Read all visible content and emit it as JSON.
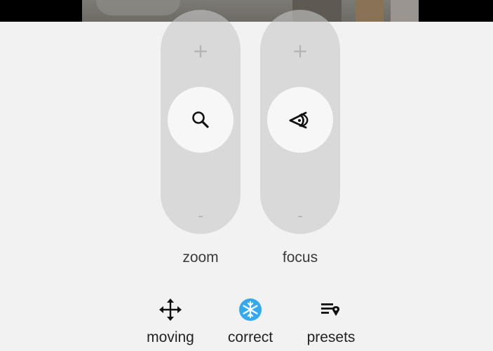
{
  "sliders": {
    "zoom": {
      "plus_label": "+",
      "minus_label": "-",
      "label": "zoom",
      "icon": "magnifier-icon"
    },
    "focus": {
      "plus_label": "+",
      "minus_label": "-",
      "label": "focus",
      "icon": "eye-focus-icon"
    }
  },
  "toolbar": {
    "items": [
      {
        "label": "moving",
        "icon": "move-arrows-icon",
        "active": false
      },
      {
        "label": "correct",
        "icon": "snowflake-icon",
        "active": true
      },
      {
        "label": "presets",
        "icon": "list-location-icon",
        "active": false
      }
    ]
  },
  "colors": {
    "background": "#f2f2f2",
    "slider_track": "#c8c8c8",
    "accent_active": "#33aaf0",
    "text": "#222222"
  }
}
